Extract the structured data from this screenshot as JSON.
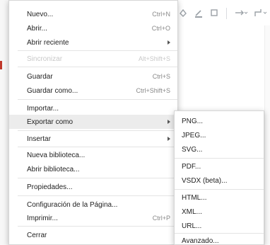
{
  "toolbar": {
    "icons": [
      "fill-color-icon",
      "line-color-icon",
      "shadow-icon",
      "connection-icon",
      "waypoints-icon"
    ]
  },
  "menu": {
    "items": [
      {
        "label": "Nuevo...",
        "shortcut": "Ctrl+N"
      },
      {
        "label": "Abrir...",
        "shortcut": "Ctrl+O"
      },
      {
        "label": "Abrir reciente",
        "submenu": true
      },
      {
        "label": "Sincronizar",
        "shortcut": "Alt+Shift+S",
        "disabled": true
      },
      {
        "label": "Guardar",
        "shortcut": "Ctrl+S"
      },
      {
        "label": "Guardar como...",
        "shortcut": "Ctrl+Shift+S"
      },
      {
        "label": "Importar..."
      },
      {
        "label": "Exportar como",
        "submenu": true,
        "selected": true
      },
      {
        "label": "Insertar",
        "submenu": true
      },
      {
        "label": "Nueva biblioteca..."
      },
      {
        "label": "Abrir biblioteca..."
      },
      {
        "label": "Propiedades..."
      },
      {
        "label": "Configuración de la Página..."
      },
      {
        "label": "Imprimir...",
        "shortcut": "Ctrl+P"
      },
      {
        "label": "Cerrar"
      }
    ]
  },
  "submenu": {
    "items": [
      {
        "label": "PNG..."
      },
      {
        "label": "JPEG..."
      },
      {
        "label": "SVG..."
      },
      {
        "label": "PDF..."
      },
      {
        "label": "VSDX (beta)..."
      },
      {
        "label": "HTML..."
      },
      {
        "label": "XML..."
      },
      {
        "label": "URL..."
      },
      {
        "label": "Avanzado..."
      }
    ]
  }
}
